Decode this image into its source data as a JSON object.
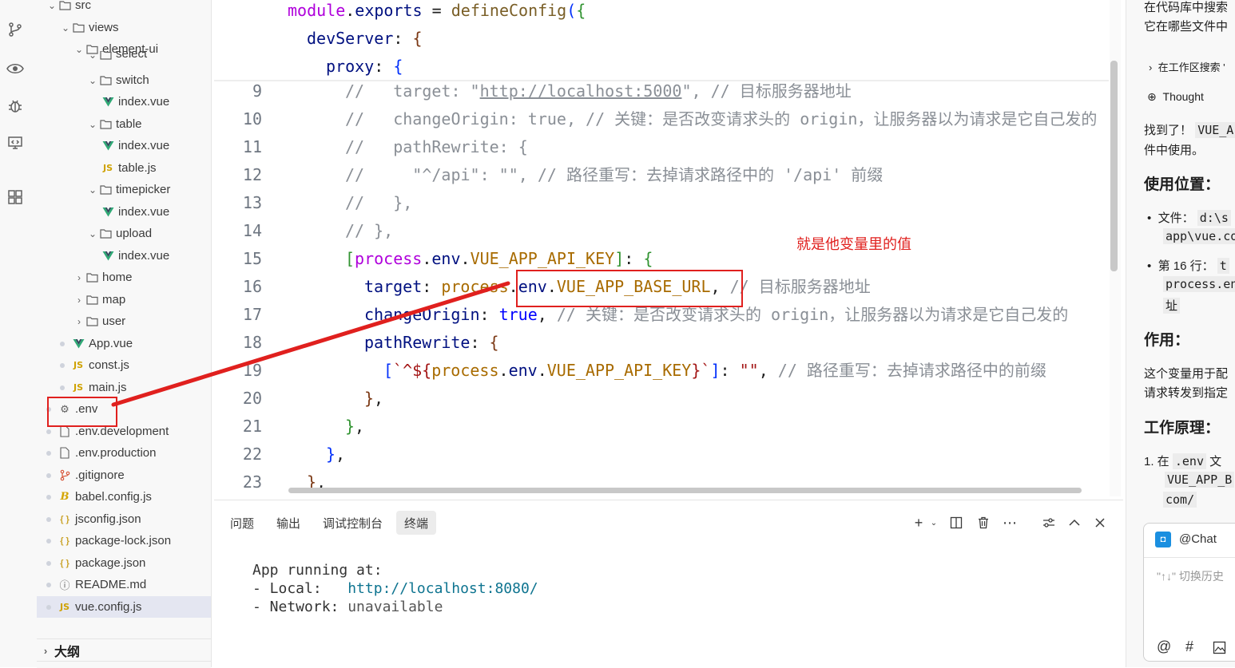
{
  "explorer": {
    "rows": [
      {
        "label": "src",
        "indent": 0,
        "type": "folder",
        "open": true
      },
      {
        "label": "views",
        "indent": 1,
        "type": "folder",
        "open": true
      },
      {
        "label": "element-ui",
        "indent": 2,
        "type": "folder",
        "open": true
      },
      {
        "label": "select",
        "indent": 3,
        "type": "folder",
        "open": true,
        "clipped": true
      },
      {
        "label": "switch",
        "indent": 3,
        "type": "folder",
        "open": true
      },
      {
        "label": "index.vue",
        "indent": 4,
        "type": "vue"
      },
      {
        "label": "table",
        "indent": 3,
        "type": "folder",
        "open": true
      },
      {
        "label": "index.vue",
        "indent": 4,
        "type": "vue"
      },
      {
        "label": "table.js",
        "indent": 4,
        "type": "js"
      },
      {
        "label": "timepicker",
        "indent": 3,
        "type": "folder",
        "open": true
      },
      {
        "label": "index.vue",
        "indent": 4,
        "type": "vue"
      },
      {
        "label": "upload",
        "indent": 3,
        "type": "folder",
        "open": true
      },
      {
        "label": "index.vue",
        "indent": 4,
        "type": "vue"
      },
      {
        "label": "home",
        "indent": 2,
        "type": "folder",
        "open": false
      },
      {
        "label": "map",
        "indent": 2,
        "type": "folder",
        "open": false
      },
      {
        "label": "user",
        "indent": 2,
        "type": "folder",
        "open": false
      },
      {
        "label": "App.vue",
        "indent": 1,
        "type": "vue",
        "dot": true
      },
      {
        "label": "const.js",
        "indent": 1,
        "type": "js",
        "dot": true
      },
      {
        "label": "main.js",
        "indent": 1,
        "type": "js",
        "dot": true
      },
      {
        "label": ".env",
        "indent": 0,
        "type": "gear",
        "dot": true
      },
      {
        "label": ".env.development",
        "indent": 0,
        "type": "file",
        "dot": true
      },
      {
        "label": ".env.production",
        "indent": 0,
        "type": "file",
        "dot": true
      },
      {
        "label": ".gitignore",
        "indent": 0,
        "type": "git",
        "dot": true
      },
      {
        "label": "babel.config.js",
        "indent": 0,
        "type": "babel",
        "dot": true
      },
      {
        "label": "jsconfig.json",
        "indent": 0,
        "type": "json",
        "dot": true
      },
      {
        "label": "package-lock.json",
        "indent": 0,
        "type": "json",
        "dot": true
      },
      {
        "label": "package.json",
        "indent": 0,
        "type": "json",
        "dot": true
      },
      {
        "label": "README.md",
        "indent": 0,
        "type": "info",
        "dot": true
      },
      {
        "label": "vue.config.js",
        "indent": 0,
        "type": "js",
        "dot": true,
        "selected": true
      }
    ],
    "outline_label": "大纲"
  },
  "icons": {
    "source_control": "source-control-icon",
    "run_debug": "run-debug-icon",
    "debug": "bug-icon",
    "remote": "remote-explorer-icon",
    "extensions": "extensions-icon"
  },
  "editor": {
    "sticky": [
      "module.exports = defineConfig({",
      "devServer: {",
      "proxy: {"
    ],
    "line_numbers": [
      "9",
      "10",
      "11",
      "12",
      "13",
      "14",
      "15",
      "16",
      "17",
      "18",
      "19",
      "20",
      "21",
      "22",
      "23"
    ],
    "lines": [
      "//   target: \"http://localhost:5000\", // 目标服务器地址",
      "//   changeOrigin: true, // 关键：是否改变请求头的 origin，让服务器以为请求是它自己发的",
      "//   pathRewrite: {",
      "//     \"^/api\": \"\", // 路径重写：去掉请求路径中的 '/api' 前缀",
      "//   },",
      "// },",
      "[process.env.VUE_APP_API_KEY]: {",
      "target: process.env.VUE_APP_BASE_URL, // 目标服务器地址",
      "changeOrigin: true, // 关键：是否改变请求头的 origin，让服务器以为请求是它自己发的",
      "pathRewrite: {",
      "[`^${process.env.VUE_APP_API_KEY}`]: \"\", // 路径重写：去掉请求路径中的前缀",
      "},",
      "},",
      "},",
      "},"
    ]
  },
  "panel": {
    "tabs": [
      "问题",
      "输出",
      "调试控制台",
      "终端"
    ],
    "active_tab": "终端",
    "terminal": {
      "line1": "App running at:",
      "local_label": "- Local:   ",
      "local_url": "http://localhost:8080/",
      "network_label": "- Network: ",
      "network_value": "unavailable"
    }
  },
  "chat": {
    "line1": "在代码库中搜索",
    "line2": "它在哪些文件中",
    "search_item": "在工作区搜索 '",
    "thought": "Thought",
    "found": "找到了！",
    "found_code": "VUE_A",
    "found_2": "件中使用。",
    "h_usage": "使用位置：",
    "file_label": "文件：",
    "file_code": "d:\\s",
    "file_code2": "app\\vue.co",
    "line_label": "第 16 行：",
    "line_code": "t",
    "line_code2": "process.en",
    "line_code3": "址",
    "h_effect": "作用：",
    "effect1": "这个变量用于配",
    "effect2": "请求转发到指定",
    "h_principle": "工作原理：",
    "p1_prefix": "1. 在",
    "p1_code": ".env",
    "p1_suffix": "文",
    "p1_code2": "VUE_APP_B",
    "p1_code3": "com/",
    "chat_tag": "@Chat",
    "input_placeholder": "\"↑↓\" 切换历史",
    "at_symbol": "@",
    "hash_symbol": "#"
  },
  "annotation": {
    "text": "就是他变量里的值",
    "color": "#e0201e"
  }
}
